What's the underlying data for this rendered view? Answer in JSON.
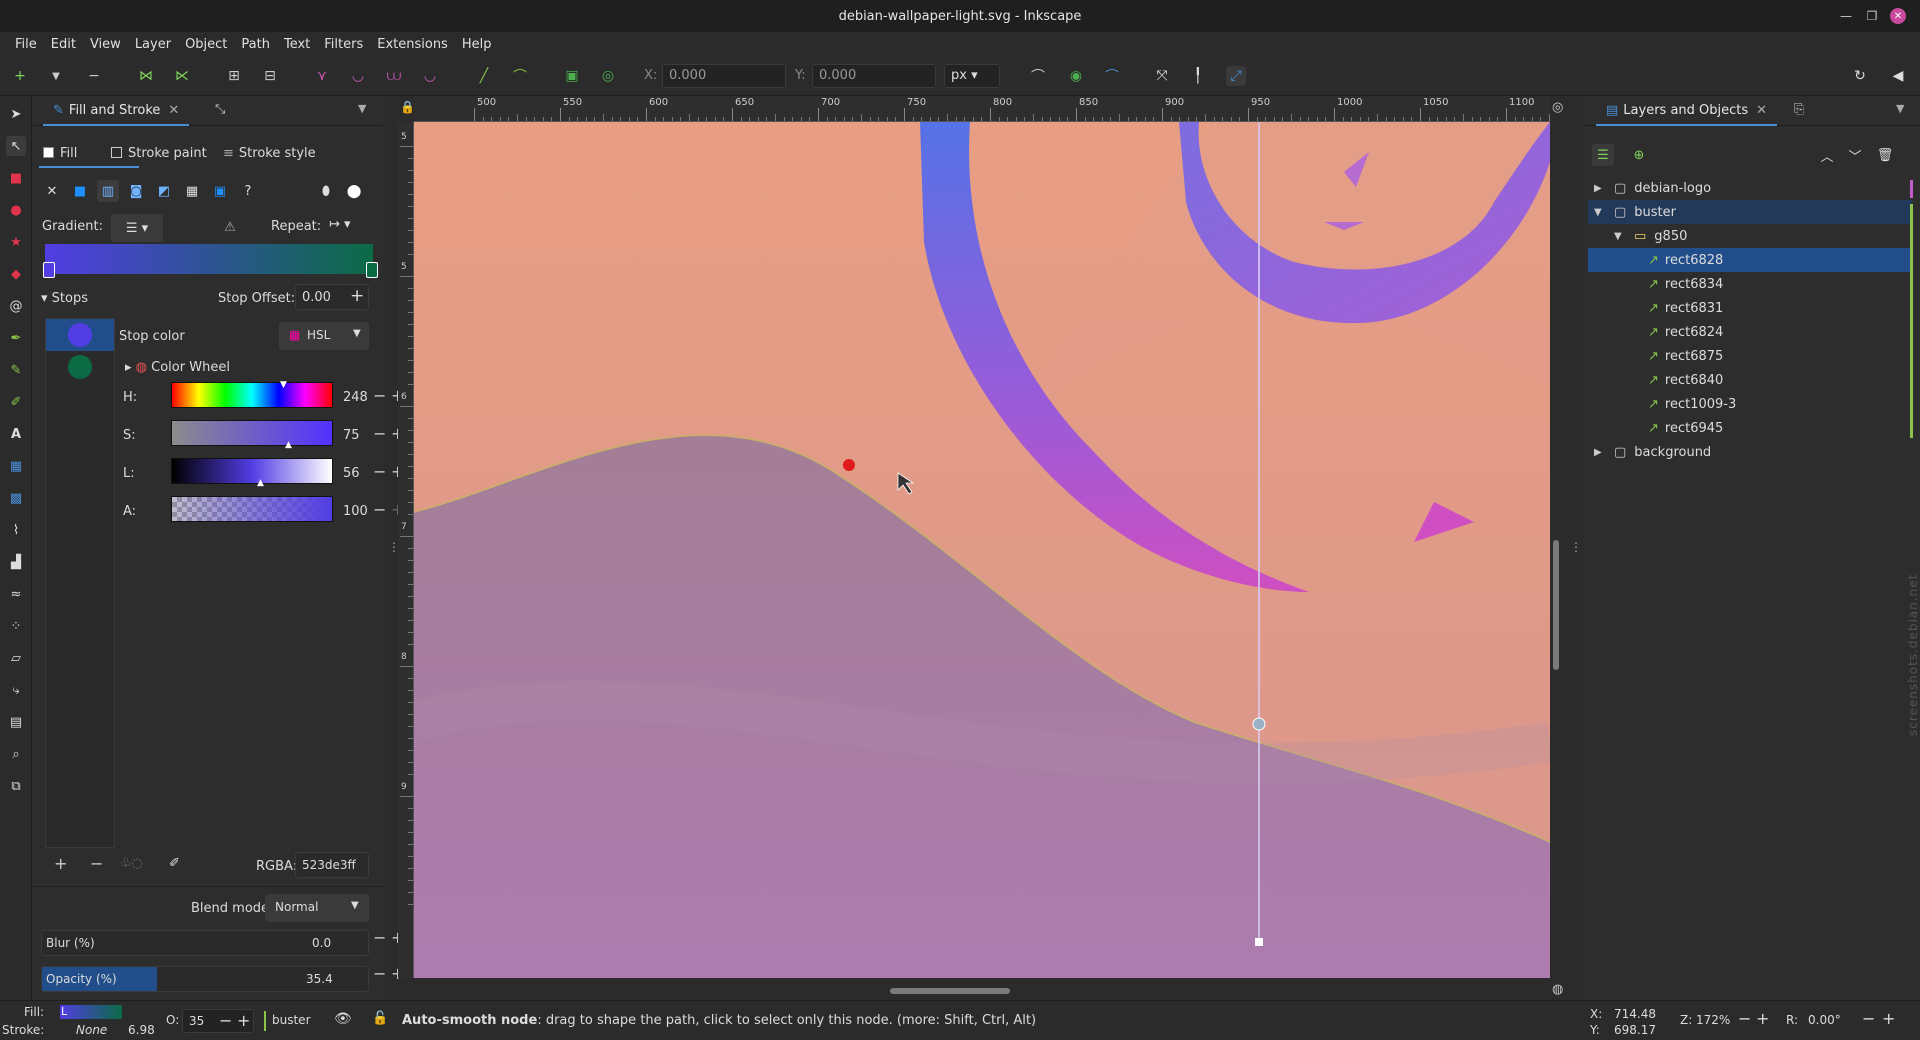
{
  "window": {
    "title": "debian-wallpaper-light.svg - Inkscape"
  },
  "menu": [
    "File",
    "Edit",
    "View",
    "Layer",
    "Object",
    "Path",
    "Text",
    "Filters",
    "Extensions",
    "Help"
  ],
  "toolctrl": {
    "x_label": "X:",
    "x_value": "0.000",
    "y_label": "Y:",
    "y_value": "0.000",
    "unit": "px"
  },
  "fill_stroke": {
    "tab_title": "Fill and Stroke",
    "tab_fill": "Fill",
    "tab_stroke_paint": "Stroke paint",
    "tab_stroke_style": "Stroke style",
    "gradient_label": "Gradient:",
    "repeat_label": "Repeat:",
    "stops_label": "Stops",
    "stop_offset_label": "Stop Offset:",
    "stop_offset_value": "0.00",
    "stop_color_label": "Stop color",
    "color_mode": "HSL",
    "color_wheel_label": "Color Wheel",
    "h_label": "H:",
    "h_value": "248",
    "s_label": "S:",
    "s_value": "75",
    "l_label": "L:",
    "l_value": "56",
    "a_label": "A:",
    "a_value": "100",
    "rgba_label": "RGBA:",
    "rgba_value": "523de3ff",
    "blend_label": "Blend mode:",
    "blend_value": "Normal",
    "blur_label": "Blur (%)",
    "blur_value": "0.0",
    "opacity_label": "Opacity (%)",
    "opacity_value": "35.4",
    "stop_colors": [
      "#523de3",
      "#0b6b45"
    ]
  },
  "ruler_top_labels": [
    "500",
    "550",
    "600",
    "650",
    "700",
    "750",
    "800",
    "850",
    "900",
    "950",
    "1000",
    "1050",
    "1100"
  ],
  "ruler_left_labels": [
    "5",
    "5",
    "6",
    "7",
    "8",
    "9"
  ],
  "layers": {
    "tab_title": "Layers and Objects",
    "items": [
      {
        "name": "debian-logo"
      },
      {
        "name": "buster"
      },
      {
        "name": "g850"
      },
      {
        "name": "rect6828"
      },
      {
        "name": "rect6834"
      },
      {
        "name": "rect6831"
      },
      {
        "name": "rect6824"
      },
      {
        "name": "rect6875"
      },
      {
        "name": "rect6840"
      },
      {
        "name": "rect1009-3"
      },
      {
        "name": "rect6945"
      },
      {
        "name": "background"
      }
    ]
  },
  "status": {
    "fill_label": "Fill:",
    "fill_value": "L",
    "stroke_label": "Stroke:",
    "stroke_value": "None",
    "stroke_width": "6.98",
    "o_label": "O:",
    "o_value": "35",
    "layer_name": "buster",
    "message_bold": "Auto-smooth node",
    "message_rest": ": drag to shape the path, click to select only this node. (more: Shift, Ctrl, Alt)",
    "x_label": "X:",
    "x_value": "714.48",
    "y_label": "Y:",
    "y_value": "698.17",
    "zoom_label": "Z:",
    "zoom_value": "172%",
    "rot_label": "R:",
    "rot_value": "0.00°"
  },
  "watermark": "screenshots.debian.net",
  "colors": {
    "accent": "#4a8fd6",
    "selection": "#214d8a",
    "node_red": "#e01b1b",
    "canvas_top": "#e89e83",
    "canvas_bottom": "#a879b3"
  }
}
